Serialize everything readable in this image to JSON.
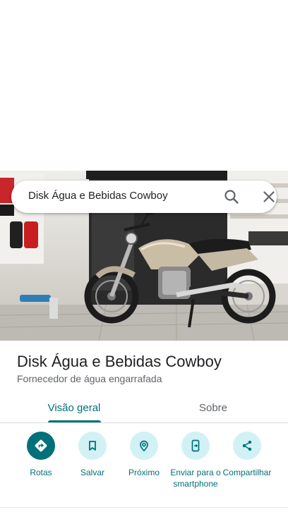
{
  "search": {
    "query": "Disk Água e Bebidas Cowboy",
    "icon": "search-icon",
    "close_icon": "close-icon"
  },
  "place": {
    "title": "Disk Água e Bebidas Cowboy",
    "category": "Fornecedor de água engarrafada"
  },
  "tabs": [
    {
      "label": "Visão geral",
      "selected": true
    },
    {
      "label": "Sobre",
      "selected": false
    }
  ],
  "actions": [
    {
      "label": "Rotas",
      "icon": "directions-icon",
      "primary": true
    },
    {
      "label": "Salvar",
      "icon": "bookmark-icon",
      "primary": false
    },
    {
      "label": "Próximo",
      "icon": "nearby-icon",
      "primary": false
    },
    {
      "label": "Enviar para o smartphone",
      "icon": "send-to-phone-icon",
      "primary": false
    },
    {
      "label": "Compartilhar",
      "icon": "share-icon",
      "primary": false
    }
  ],
  "colors": {
    "accent": "#00707a",
    "accent_light": "#d1f1f5",
    "title_text": "#202124",
    "secondary_text": "#5f6368"
  }
}
